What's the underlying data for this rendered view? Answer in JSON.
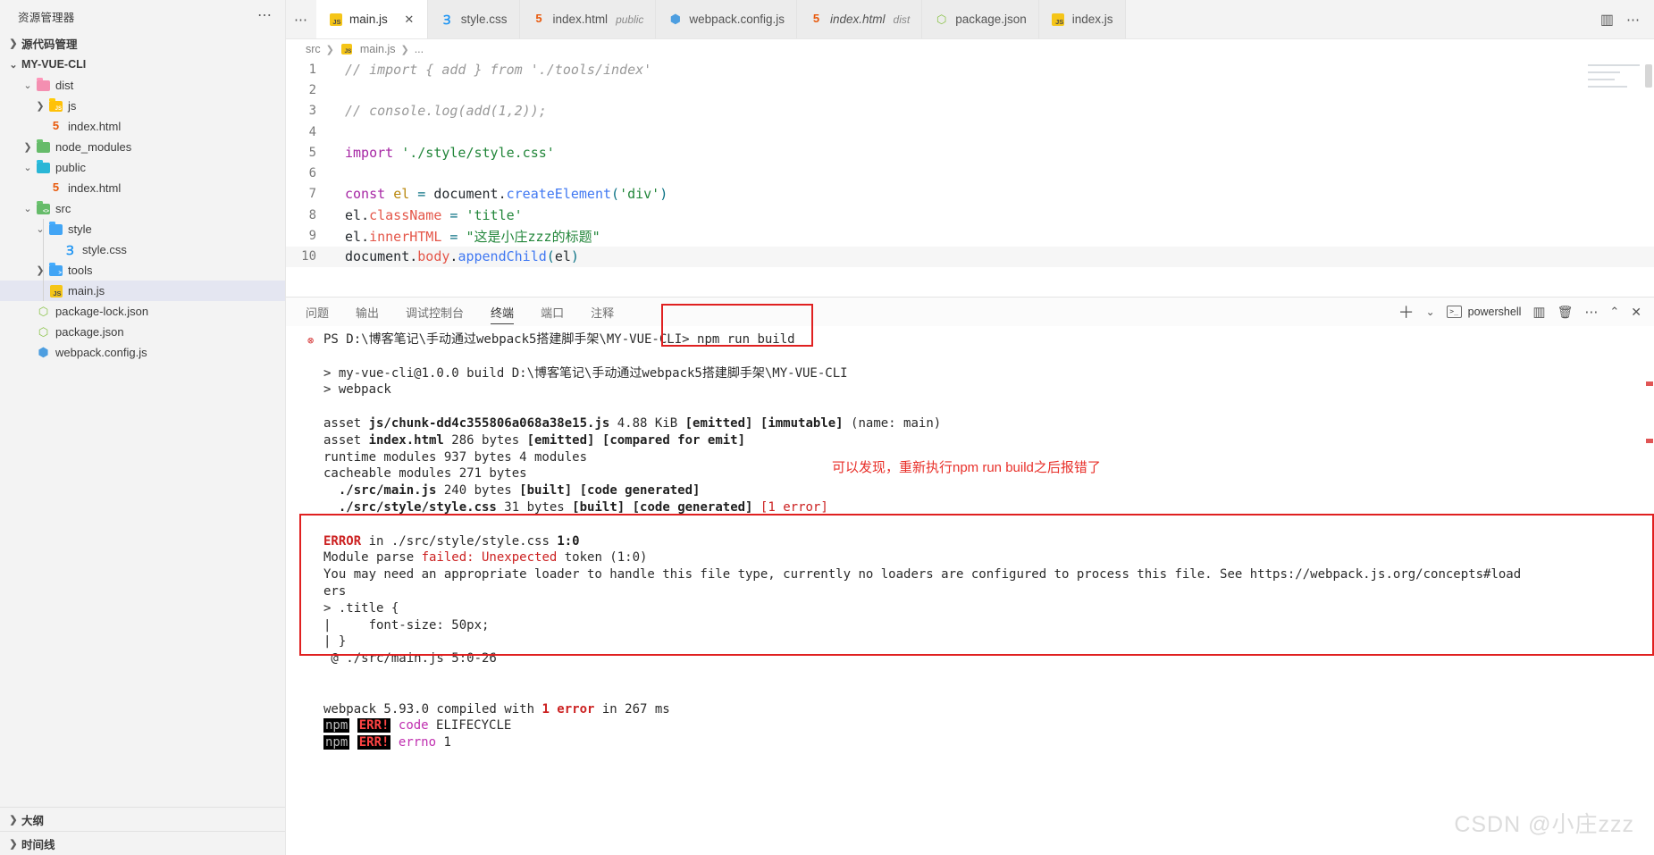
{
  "sidebar": {
    "title": "资源管理器",
    "more_icon": "ellipsis-icon",
    "sections": [
      {
        "label": "源代码管理",
        "expanded": false
      },
      {
        "label": "MY-VUE-CLI",
        "expanded": true
      }
    ],
    "tree": [
      {
        "label": "dist",
        "icon": "folder-pink",
        "depth": 1,
        "twisty": "down",
        "selected": false
      },
      {
        "label": "js",
        "icon": "folder-yellow-js",
        "depth": 2,
        "twisty": "right",
        "selected": false
      },
      {
        "label": "index.html",
        "icon": "html5-icon",
        "depth": 3,
        "twisty": "none",
        "selected": false
      },
      {
        "label": "node_modules",
        "icon": "folder-green",
        "depth": 1,
        "twisty": "right",
        "selected": false
      },
      {
        "label": "public",
        "icon": "folder-blue-public",
        "depth": 1,
        "twisty": "down",
        "selected": false
      },
      {
        "label": "index.html",
        "icon": "html5-icon",
        "depth": 3,
        "twisty": "none",
        "selected": false
      },
      {
        "label": "src",
        "icon": "folder-green-src",
        "depth": 1,
        "twisty": "down",
        "selected": false
      },
      {
        "label": "style",
        "icon": "folder-blue-style",
        "depth": 2,
        "twisty": "down",
        "selected": false
      },
      {
        "label": "style.css",
        "icon": "css3-icon",
        "depth": 4,
        "twisty": "none",
        "selected": false
      },
      {
        "label": "tools",
        "icon": "folder-blue",
        "depth": 2,
        "twisty": "right",
        "selected": false
      },
      {
        "label": "main.js",
        "icon": "js-icon",
        "depth": 3,
        "twisty": "none",
        "selected": true
      },
      {
        "label": "package-lock.json",
        "icon": "node-icon",
        "depth": 1,
        "twisty": "none",
        "selected": false
      },
      {
        "label": "package.json",
        "icon": "node-icon",
        "depth": 1,
        "twisty": "none",
        "selected": false
      },
      {
        "label": "webpack.config.js",
        "icon": "webpack-icon",
        "depth": 1,
        "twisty": "none",
        "selected": false
      }
    ],
    "bottom_sections": [
      {
        "label": "大纲"
      },
      {
        "label": "时间线"
      }
    ]
  },
  "tabs": [
    {
      "name": "main.js",
      "sub": "",
      "icon": "js-icon",
      "active": true,
      "italic": false,
      "closable": true
    },
    {
      "name": "style.css",
      "sub": "",
      "icon": "css3-icon",
      "active": false,
      "italic": false,
      "closable": false
    },
    {
      "name": "index.html",
      "sub": "public",
      "icon": "html5-icon",
      "active": false,
      "italic": false,
      "closable": false
    },
    {
      "name": "webpack.config.js",
      "sub": "",
      "icon": "webpack-icon",
      "active": false,
      "italic": false,
      "closable": false
    },
    {
      "name": "index.html",
      "sub": "dist",
      "icon": "html5-icon",
      "active": false,
      "italic": true,
      "closable": false
    },
    {
      "name": "package.json",
      "sub": "",
      "icon": "node-icon",
      "active": false,
      "italic": false,
      "closable": false
    },
    {
      "name": "index.js",
      "sub": "",
      "icon": "js-icon",
      "active": false,
      "italic": false,
      "closable": false
    }
  ],
  "tabbar_actions": [
    {
      "icon": "split-editor-icon"
    },
    {
      "icon": "ellipsis-icon"
    }
  ],
  "breadcrumb": [
    "src",
    "main.js",
    "..."
  ],
  "editor": {
    "file": "main.js",
    "lines": [
      {
        "n": "1",
        "tokens": [
          {
            "t": "// import { add } from './tools/index'",
            "c": "cmt"
          }
        ]
      },
      {
        "n": "2",
        "tokens": []
      },
      {
        "n": "3",
        "tokens": [
          {
            "t": "// console.log(add(1,2));",
            "c": "cmt"
          }
        ]
      },
      {
        "n": "4",
        "tokens": []
      },
      {
        "n": "5",
        "tokens": [
          {
            "t": "import",
            "c": "kw"
          },
          {
            "t": " ",
            "c": "plain"
          },
          {
            "t": "'./style/style.css'",
            "c": "str"
          }
        ]
      },
      {
        "n": "6",
        "tokens": []
      },
      {
        "n": "7",
        "tokens": [
          {
            "t": "const",
            "c": "kw"
          },
          {
            "t": " ",
            "c": "plain"
          },
          {
            "t": "el",
            "c": "var"
          },
          {
            "t": " ",
            "c": "plain"
          },
          {
            "t": "=",
            "c": "op"
          },
          {
            "t": " ",
            "c": "plain"
          },
          {
            "t": "document",
            "c": "plain"
          },
          {
            "t": ".",
            "c": "punct"
          },
          {
            "t": "createElement",
            "c": "fn"
          },
          {
            "t": "(",
            "c": "op"
          },
          {
            "t": "'div'",
            "c": "str"
          },
          {
            "t": ")",
            "c": "op"
          }
        ]
      },
      {
        "n": "8",
        "tokens": [
          {
            "t": "el",
            "c": "plain"
          },
          {
            "t": ".",
            "c": "punct"
          },
          {
            "t": "className",
            "c": "prop"
          },
          {
            "t": " ",
            "c": "plain"
          },
          {
            "t": "=",
            "c": "op"
          },
          {
            "t": " ",
            "c": "plain"
          },
          {
            "t": "'title'",
            "c": "str"
          }
        ]
      },
      {
        "n": "9",
        "tokens": [
          {
            "t": "el",
            "c": "plain"
          },
          {
            "t": ".",
            "c": "punct"
          },
          {
            "t": "innerHTML",
            "c": "prop"
          },
          {
            "t": " ",
            "c": "plain"
          },
          {
            "t": "=",
            "c": "op"
          },
          {
            "t": " ",
            "c": "plain"
          },
          {
            "t": "\"这是小庄zzz的标题\"",
            "c": "str"
          }
        ]
      },
      {
        "n": "10",
        "tokens": [
          {
            "t": "document",
            "c": "plain"
          },
          {
            "t": ".",
            "c": "punct"
          },
          {
            "t": "body",
            "c": "prop"
          },
          {
            "t": ".",
            "c": "punct"
          },
          {
            "t": "appendChild",
            "c": "fn"
          },
          {
            "t": "(",
            "c": "op"
          },
          {
            "t": "el",
            "c": "plain"
          },
          {
            "t": ")",
            "c": "op"
          }
        ],
        "current": true
      }
    ]
  },
  "panel": {
    "tabs": [
      {
        "label": "问题",
        "active": false
      },
      {
        "label": "输出",
        "active": false
      },
      {
        "label": "调试控制台",
        "active": false
      },
      {
        "label": "终端",
        "active": true
      },
      {
        "label": "端口",
        "active": false
      },
      {
        "label": "注释",
        "active": false
      }
    ],
    "terminal_name": "powershell",
    "actions": [
      {
        "icon": "plus-icon"
      },
      {
        "icon": "chevron-down-icon"
      },
      {
        "icon": "split-terminal-icon"
      },
      {
        "icon": "trash-icon"
      },
      {
        "icon": "ellipsis-icon"
      },
      {
        "icon": "chevron-up-icon"
      },
      {
        "icon": "close-icon"
      }
    ]
  },
  "terminal": {
    "prompt_prefix": "PS D:\\博客笔记\\手动通过webpack5搭建脚手架\\MY-VUE-CLI> ",
    "command": "npm run build",
    "lines": [
      {
        "parts": [
          {
            "t": "> my-vue-cli@1.0.0 build D:\\博客笔记\\手动通过webpack5搭建脚手架\\MY-VUE-CLI",
            "c": "plain"
          }
        ]
      },
      {
        "parts": [
          {
            "t": "> webpack",
            "c": "plain"
          }
        ]
      },
      {
        "parts": []
      },
      {
        "parts": [
          {
            "t": "asset ",
            "c": "plain"
          },
          {
            "t": "js/chunk-dd4c355806a068a38e15.js",
            "c": "gb"
          },
          {
            "t": " 4.88 KiB ",
            "c": "plain"
          },
          {
            "t": "[emitted]",
            "c": "gb"
          },
          {
            "t": " ",
            "c": "plain"
          },
          {
            "t": "[immutable]",
            "c": "gb"
          },
          {
            "t": " (name: main)",
            "c": "plain"
          }
        ]
      },
      {
        "parts": [
          {
            "t": "asset ",
            "c": "plain"
          },
          {
            "t": "index.html",
            "c": "gb"
          },
          {
            "t": " 286 bytes ",
            "c": "plain"
          },
          {
            "t": "[emitted]",
            "c": "gb"
          },
          {
            "t": " ",
            "c": "plain"
          },
          {
            "t": "[compared for emit]",
            "c": "gb"
          }
        ]
      },
      {
        "parts": [
          {
            "t": "runtime modules 937 bytes 4 modules",
            "c": "plain"
          }
        ]
      },
      {
        "parts": [
          {
            "t": "cacheable modules 271 bytes",
            "c": "plain"
          }
        ]
      },
      {
        "parts": [
          {
            "t": "  ./src/main.js",
            "c": "b"
          },
          {
            "t": " 240 bytes ",
            "c": "plain"
          },
          {
            "t": "[built]",
            "c": "gb"
          },
          {
            "t": " ",
            "c": "plain"
          },
          {
            "t": "[code generated]",
            "c": "gb"
          }
        ]
      },
      {
        "parts": [
          {
            "t": "  ./src/style/style.css",
            "c": "b"
          },
          {
            "t": " 31 bytes ",
            "c": "plain"
          },
          {
            "t": "[built]",
            "c": "gb"
          },
          {
            "t": " ",
            "c": "plain"
          },
          {
            "t": "[code generated]",
            "c": "gb"
          },
          {
            "t": " ",
            "c": "plain"
          },
          {
            "t": "[1 error]",
            "c": "r"
          }
        ]
      },
      {
        "parts": []
      },
      {
        "parts": [
          {
            "t": "ERROR",
            "c": "rb"
          },
          {
            "t": " in ./src/style/style.css ",
            "c": "plain"
          },
          {
            "t": "1:0",
            "c": "gb"
          }
        ]
      },
      {
        "parts": [
          {
            "t": "Module parse ",
            "c": "plain"
          },
          {
            "t": "failed: Unexpected",
            "c": "r"
          },
          {
            "t": " token (1:0)",
            "c": "plain"
          }
        ]
      },
      {
        "parts": [
          {
            "t": "You may need an appropriate loader to handle this file type, currently no loaders are configured to process this file. See https://webpack.js.org/concepts#load",
            "c": "plain"
          }
        ]
      },
      {
        "parts": [
          {
            "t": "ers",
            "c": "plain"
          }
        ]
      },
      {
        "parts": [
          {
            "t": "> .title {",
            "c": "plain"
          }
        ]
      },
      {
        "parts": [
          {
            "t": "|     font-size: 50px;",
            "c": "plain"
          }
        ]
      },
      {
        "parts": [
          {
            "t": "| }",
            "c": "plain"
          }
        ]
      },
      {
        "parts": [
          {
            "t": " @ ./src/main.js 5:0-26",
            "c": "plain"
          }
        ]
      },
      {
        "parts": []
      },
      {
        "parts": []
      },
      {
        "parts": [
          {
            "t": "webpack 5.93.0 compiled with ",
            "c": "plain"
          },
          {
            "t": "1 error",
            "c": "rb"
          },
          {
            "t": " in 267 ms",
            "c": "plain"
          }
        ]
      },
      {
        "parts": [
          {
            "t": "npm",
            "c": "npmbadge"
          },
          {
            "t": " ",
            "c": "plain"
          },
          {
            "t": "ERR!",
            "c": "errbadge"
          },
          {
            "t": " ",
            "c": "plain"
          },
          {
            "t": "code",
            "c": "m"
          },
          {
            "t": " ELIFECYCLE",
            "c": "plain"
          }
        ]
      },
      {
        "parts": [
          {
            "t": "npm",
            "c": "npmbadge"
          },
          {
            "t": " ",
            "c": "plain"
          },
          {
            "t": "ERR!",
            "c": "errbadge"
          },
          {
            "t": " ",
            "c": "plain"
          },
          {
            "t": "errno",
            "c": "m"
          },
          {
            "t": " 1",
            "c": "plain"
          }
        ]
      }
    ]
  },
  "annotations": {
    "note_text": "可以发现，重新执行npm run build之后报错了",
    "note_color": "#e8302a",
    "box_color": "#e02020"
  },
  "watermark": "CSDN @小庄zzz"
}
